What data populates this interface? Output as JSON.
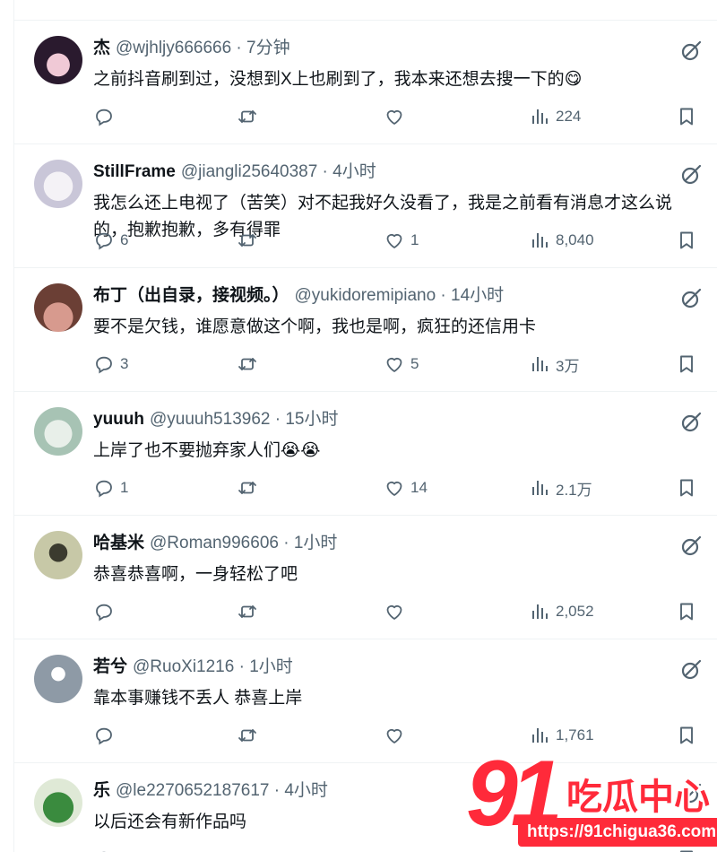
{
  "feed": {
    "tweets": [
      {
        "name": "杰",
        "meta": "@wjhljy666666 · 7分钟",
        "text": [
          "之前抖音刷到过，没想到X上也刷到了，我本来还想去搜一下的😋"
        ],
        "replies": "",
        "retweets": "",
        "likes": "",
        "views": "224"
      },
      {
        "name": "StillFrame",
        "meta": "@jiangli25640387 · 4小时",
        "text": [
          "我怎么还上电视了（苦笑）对不起我好久没看了，我是之前看有消息才这么说",
          "的，抱歉抱歉，多有得罪"
        ],
        "replies": "6",
        "retweets": "",
        "likes": "1",
        "views": "8,040"
      },
      {
        "name": "布丁（出自录，接视频。）",
        "meta": "@yukidoremipiano · 14小时",
        "text": [
          "要不是欠钱，谁愿意做这个啊，我也是啊，疯狂的还信用卡"
        ],
        "replies": "3",
        "retweets": "",
        "likes": "5",
        "views": "3万"
      },
      {
        "name": "yuuuh",
        "meta": "@yuuuh513962 · 15小时",
        "text": [
          "上岸了也不要抛弃家人们😭😭"
        ],
        "replies": "1",
        "retweets": "",
        "likes": "14",
        "views": "2.1万"
      },
      {
        "name": "哈基米",
        "meta": "@Roman996606 · 1小时",
        "text": [
          "恭喜恭喜啊，一身轻松了吧"
        ],
        "replies": "",
        "retweets": "",
        "likes": "",
        "views": "2,052"
      },
      {
        "name": "若兮",
        "meta": "@RuoXi1216 · 1小时",
        "text": [
          "靠本事赚钱不丢人 恭喜上岸"
        ],
        "replies": "",
        "retweets": "",
        "likes": "",
        "views": "1,761"
      },
      {
        "name": "乐",
        "meta": "@le2270652187617 · 4小时",
        "text": [
          "以后还会有新作品吗"
        ],
        "replies": "",
        "retweets": "",
        "likes": "",
        "views": ""
      }
    ]
  },
  "watermark": {
    "number": "91",
    "brand": "吃瓜中心",
    "url": "https://91chigua36.com"
  },
  "colors": {
    "text": "#0f1419",
    "muted": "#536471",
    "border": "#eff3f4",
    "watermark": "#ff2a3a"
  },
  "icons": [
    "reply-icon",
    "retweet-icon",
    "like-icon",
    "views-icon",
    "bookmark-icon",
    "share-icon",
    "grok-icon",
    "more-icon"
  ]
}
